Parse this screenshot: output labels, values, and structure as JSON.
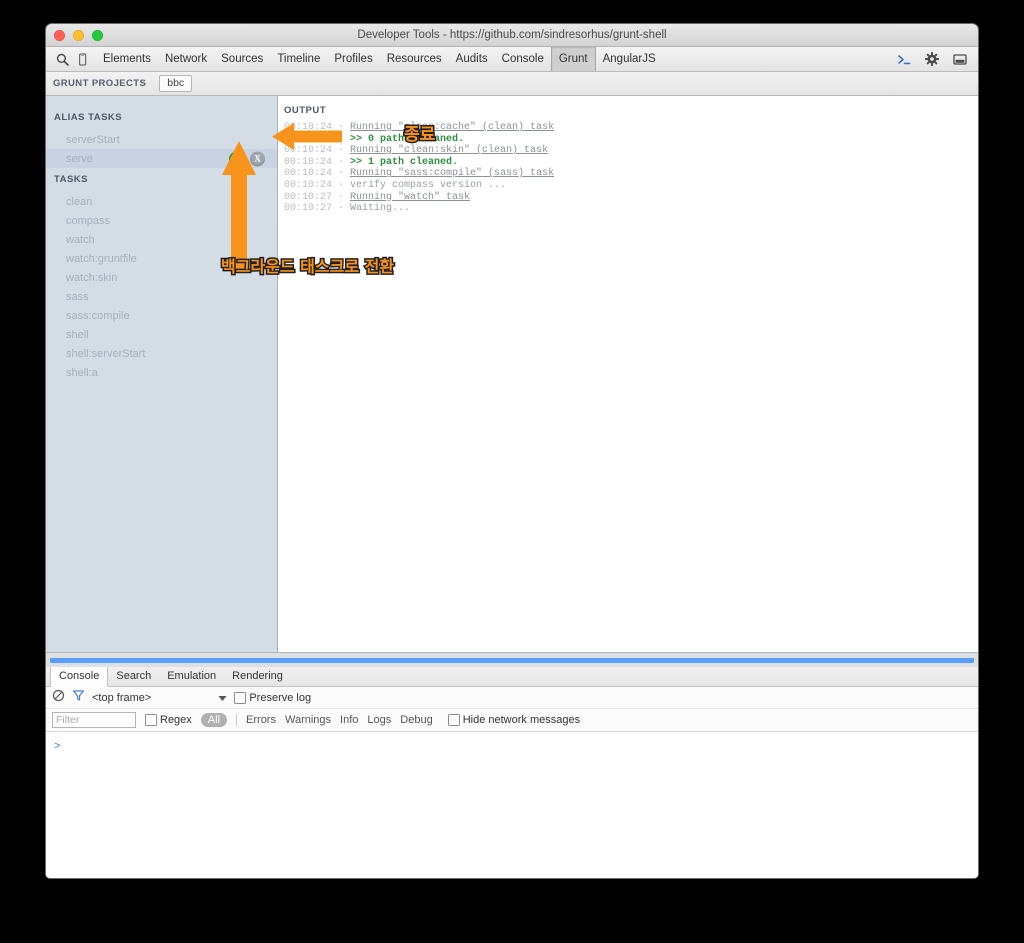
{
  "window": {
    "title": "Developer Tools - https://github.com/sindresorhus/grunt-shell",
    "traffic_lights": [
      "close-red",
      "minimize-yellow",
      "zoom-green"
    ]
  },
  "toolbar": {
    "left_icons": [
      "search-icon",
      "device-mode-icon"
    ],
    "tabs": [
      {
        "label": "Elements",
        "active": false
      },
      {
        "label": "Network",
        "active": false
      },
      {
        "label": "Sources",
        "active": false
      },
      {
        "label": "Timeline",
        "active": false
      },
      {
        "label": "Profiles",
        "active": false
      },
      {
        "label": "Resources",
        "active": false
      },
      {
        "label": "Audits",
        "active": false
      },
      {
        "label": "Console",
        "active": false
      },
      {
        "label": "Grunt",
        "active": true
      },
      {
        "label": "AngularJS",
        "active": false
      }
    ],
    "right_icons": [
      "console-toggle-icon",
      "gear-icon",
      "dock-icon"
    ]
  },
  "projects_bar": {
    "label": "GRUNT PROJECTS",
    "project_chip": "bbc"
  },
  "sidebar": {
    "alias_tasks_header": "ALIAS TASKS",
    "alias_tasks": [
      {
        "label": "serverStart",
        "selected": false,
        "badges": []
      },
      {
        "label": "serve",
        "selected": true,
        "badges": [
          {
            "name": "background-task-badge",
            "text": "B",
            "color": "#27a62b"
          },
          {
            "name": "stop-task-badge",
            "text": "X",
            "color": "#9fa6ae"
          }
        ]
      }
    ],
    "tasks_header": "TASKS",
    "tasks": [
      {
        "label": "clean"
      },
      {
        "label": "compass"
      },
      {
        "label": "watch"
      },
      {
        "label": "watch:gruntfile"
      },
      {
        "label": "watch:skin"
      },
      {
        "label": "sass"
      },
      {
        "label": "sass:compile"
      },
      {
        "label": "shell"
      },
      {
        "label": "shell:serverStart"
      },
      {
        "label": "shell:a"
      }
    ]
  },
  "output": {
    "header": "OUTPUT",
    "lines": [
      {
        "ts": "00:10:24",
        "kind": "link",
        "text": "Running \"clean:cache\" (clean) task"
      },
      {
        "ts": "00:10:24",
        "kind": "arrow",
        "text": ">> 0 paths cleaned."
      },
      {
        "ts": "00:10:24",
        "kind": "link",
        "text": "Running \"clean:skin\" (clean) task"
      },
      {
        "ts": "00:10:24",
        "kind": "arrow",
        "text": ">> 1 path cleaned."
      },
      {
        "ts": "00:10:24",
        "kind": "link",
        "text": "Running \"sass:compile\" (sass) task"
      },
      {
        "ts": "00:10:24",
        "kind": "plain",
        "text": "verify compass version ..."
      },
      {
        "ts": "00:10:27",
        "kind": "link",
        "text": "Running \"watch\" task"
      },
      {
        "ts": "00:10:27",
        "kind": "plain",
        "text": "Waiting..."
      }
    ]
  },
  "annotations": {
    "color": "#f7941e",
    "outline": "#231f20",
    "stop_label": "종료",
    "background_label": "백그라운드 태스크로 전환"
  },
  "drawer": {
    "tabs": [
      {
        "label": "Console",
        "active": true
      },
      {
        "label": "Search",
        "active": false
      },
      {
        "label": "Emulation",
        "active": false
      },
      {
        "label": "Rendering",
        "active": false
      }
    ],
    "toolbar_row1": {
      "clear_icon": "clear-console-icon",
      "filter_icon": "funnel-icon",
      "context_selector": "<top frame>",
      "dropdown_icon": "chevron-down-icon",
      "preserve_log_label": "Preserve log",
      "preserve_log_checked": false
    },
    "toolbar_row2": {
      "filter_placeholder": "Filter",
      "filter_value": "",
      "regex_label": "Regex",
      "regex_checked": false,
      "levels": [
        {
          "label": "All",
          "active": true
        },
        {
          "label": "Errors",
          "active": false
        },
        {
          "label": "Warnings",
          "active": false
        },
        {
          "label": "Info",
          "active": false
        },
        {
          "label": "Logs",
          "active": false
        },
        {
          "label": "Debug",
          "active": false
        }
      ],
      "hide_network_label": "Hide network messages",
      "hide_network_checked": false
    },
    "prompt_symbol": ">"
  }
}
